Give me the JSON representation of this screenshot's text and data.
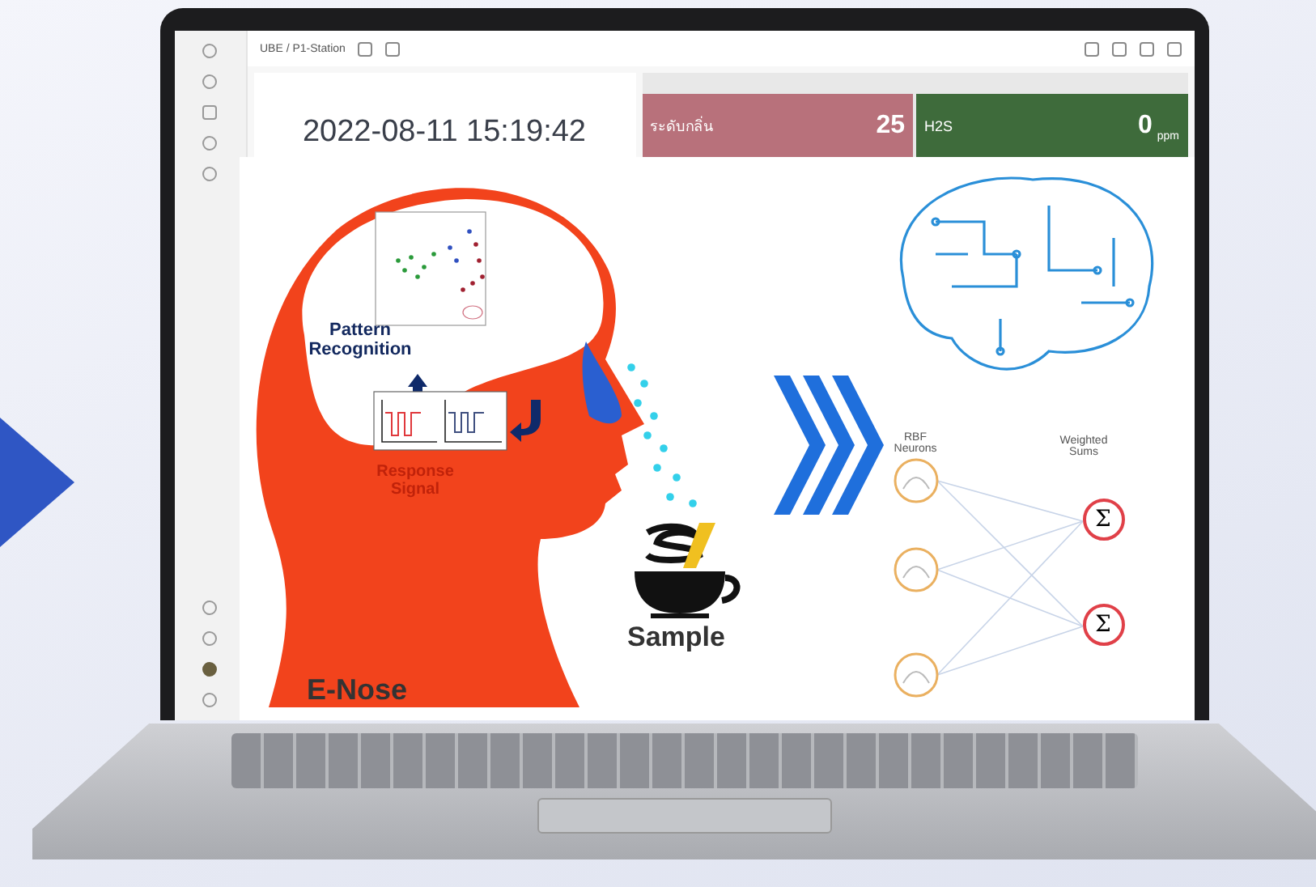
{
  "dashboard": {
    "breadcrumb": "UBE / P1-Station",
    "time_value": "2022-08-11 15:19:42",
    "sensors": [
      {
        "label": "ระดับกลิ่น",
        "value": "25",
        "color": "#b8717b"
      },
      {
        "label": "H2S",
        "value": "0",
        "unit": "ppm",
        "color": "#3e6b3b"
      }
    ]
  },
  "infographic": {
    "pattern_label": "Pattern Recognition",
    "response_label": "Response Signal",
    "device_label": "E-Nose",
    "sample_label": "Sample",
    "network": {
      "input_title": "RBF Neurons",
      "output_title": "Weighted Sums",
      "outputs": [
        "Σ",
        "Σ"
      ]
    }
  }
}
